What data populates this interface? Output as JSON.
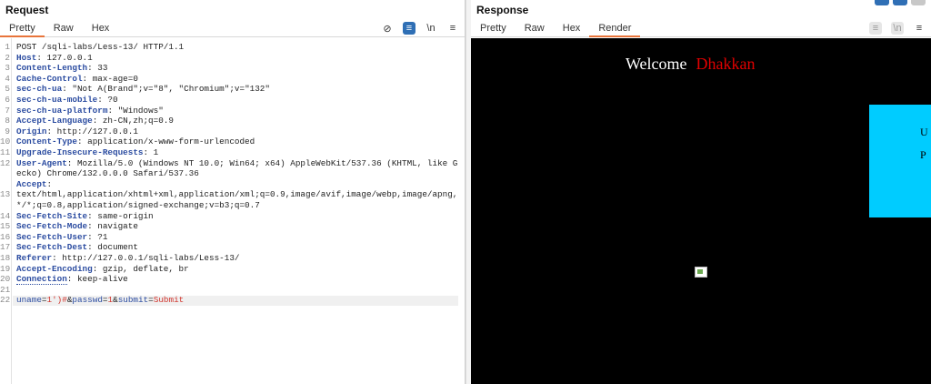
{
  "request": {
    "title": "Request",
    "tabs": [
      "Pretty",
      "Raw",
      "Hex"
    ],
    "active_tab": "Pretty",
    "tools": [
      "eye-off-icon",
      "wrap-lines-icon",
      "newline-icon",
      "menu-icon"
    ],
    "tool_glyphs": [
      "⊘",
      "≡",
      "\\n",
      "≡"
    ],
    "lines": [
      {
        "n": "1",
        "text": "POST /sqli-labs/Less-13/ HTTP/1.1"
      },
      {
        "n": "2",
        "key": "Host",
        "value": ": 127.0.0.1"
      },
      {
        "n": "3",
        "key": "Content-Length",
        "value": ": 33"
      },
      {
        "n": "4",
        "key": "Cache-Control",
        "value": ": max-age=0"
      },
      {
        "n": "5",
        "key": "sec-ch-ua",
        "value": ": \"Not A(Brand\";v=\"8\", \"Chromium\";v=\"132\""
      },
      {
        "n": "6",
        "key": "sec-ch-ua-mobile",
        "value": ": ?0"
      },
      {
        "n": "7",
        "key": "sec-ch-ua-platform",
        "value": ": \"Windows\""
      },
      {
        "n": "8",
        "key": "Accept-Language",
        "value": ": zh-CN,zh;q=0.9"
      },
      {
        "n": "9",
        "key": "Origin",
        "value": ": http://127.0.0.1"
      },
      {
        "n": "10",
        "key": "Content-Type",
        "value": ": application/x-www-form-urlencoded"
      },
      {
        "n": "11",
        "key": "Upgrade-Insecure-Requests",
        "value": ": 1"
      },
      {
        "n": "12",
        "key": "User-Agent",
        "value": ": Mozilla/5.0 (Windows NT 10.0; Win64; x64) AppleWebKit/537.36 (KHTML, like Gecko) Chrome/132.0.0.0 Safari/537.36"
      },
      {
        "n": "13",
        "key": "Accept",
        "value": ":\ntext/html,application/xhtml+xml,application/xml;q=0.9,image/avif,image/webp,image/apng,*/*;q=0.8,application/signed-exchange;v=b3;q=0.7"
      },
      {
        "n": "14",
        "key": "Sec-Fetch-Site",
        "value": ": same-origin"
      },
      {
        "n": "15",
        "key": "Sec-Fetch-Mode",
        "value": ": navigate"
      },
      {
        "n": "16",
        "key": "Sec-Fetch-User",
        "value": ": ?1"
      },
      {
        "n": "17",
        "key": "Sec-Fetch-Dest",
        "value": ": document"
      },
      {
        "n": "18",
        "key": "Referer",
        "value": ": http://127.0.0.1/sqli-labs/Less-13/"
      },
      {
        "n": "19",
        "key": "Accept-Encoding",
        "value": ": gzip, deflate, br"
      },
      {
        "n": "20",
        "key": "Connection",
        "value": ": keep-alive"
      },
      {
        "n": "21",
        "text": ""
      },
      {
        "n": "22",
        "body": [
          {
            "name": "uname",
            "value": "1')#"
          },
          {
            "name": "passwd",
            "value": "1"
          },
          {
            "name": "submit",
            "value": "Submit"
          }
        ]
      }
    ]
  },
  "response": {
    "title": "Response",
    "tabs": [
      "Pretty",
      "Raw",
      "Hex",
      "Render"
    ],
    "active_tab": "Render",
    "tools": [
      "wrap-lines-icon",
      "newline-icon",
      "menu-icon"
    ],
    "tool_glyphs": [
      "≡",
      "\\n",
      "≡"
    ],
    "render": {
      "welcome": "Welcome",
      "name": "Dhakkan",
      "panel_letters": [
        "U",
        "P"
      ]
    }
  },
  "colors": {
    "accent": "#e8743b",
    "header_key": "#2a4ba0",
    "param_value": "#d0342c",
    "render_bg": "#000000",
    "panel_cyan": "#00ccff",
    "welcome_name": "#e00000"
  }
}
